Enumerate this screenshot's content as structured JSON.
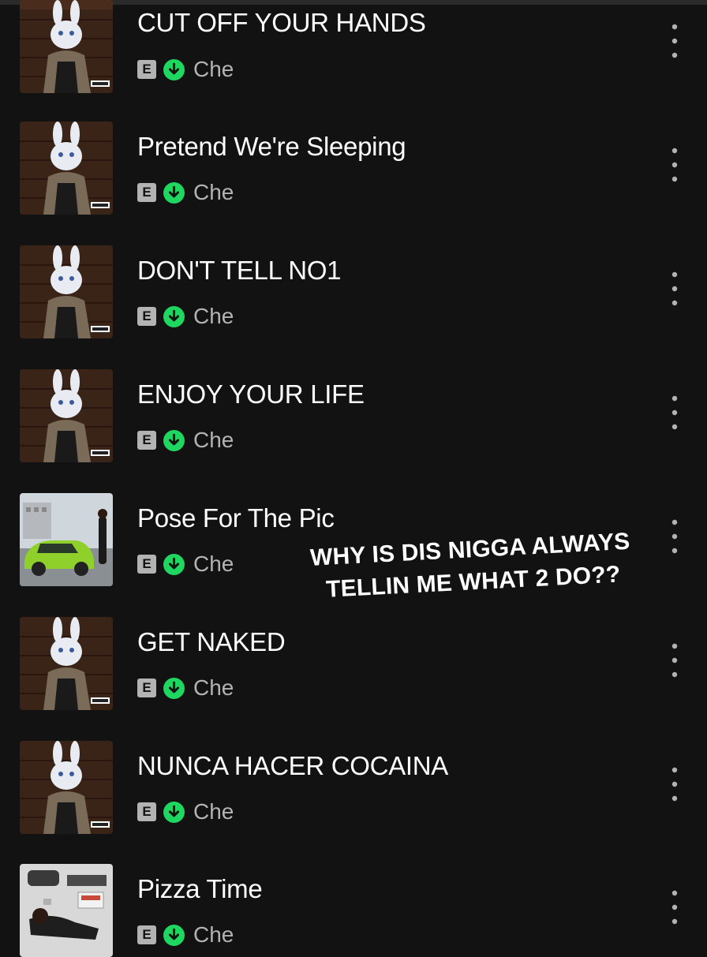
{
  "tracks": [
    {
      "title": "CUT OFF YOUR HANDS",
      "explicit": "E",
      "artist": "Che",
      "cover": "bunny-mask-cover"
    },
    {
      "title": "Pretend We're Sleeping",
      "explicit": "E",
      "artist": "Che",
      "cover": "bunny-mask-cover"
    },
    {
      "title": "DON'T TELL NO1",
      "explicit": "E",
      "artist": "Che",
      "cover": "bunny-mask-cover"
    },
    {
      "title": "ENJOY YOUR LIFE",
      "explicit": "E",
      "artist": "Che",
      "cover": "bunny-mask-cover"
    },
    {
      "title": "Pose For The Pic",
      "explicit": "E",
      "artist": "Che",
      "cover": "green-sports-car-cover"
    },
    {
      "title": "GET NAKED",
      "explicit": "E",
      "artist": "Che",
      "cover": "bunny-mask-cover"
    },
    {
      "title": "NUNCA HACER COCAINA",
      "explicit": "E",
      "artist": "Che",
      "cover": "bunny-mask-cover"
    },
    {
      "title": "Pizza Time",
      "explicit": "E",
      "artist": "Che",
      "cover": "pizza-box-cover"
    }
  ],
  "overlay_caption": {
    "line1": "WHY IS DIS NIGGA ALWAYS",
    "line2": "TELLIN ME WHAT 2 DO??"
  },
  "icons": {
    "downloaded": "download-circle-icon",
    "more": "more-vertical-icon"
  },
  "colors": {
    "background": "#121212",
    "downloaded_green": "#1ed760",
    "secondary_text": "#b3b3b3"
  }
}
